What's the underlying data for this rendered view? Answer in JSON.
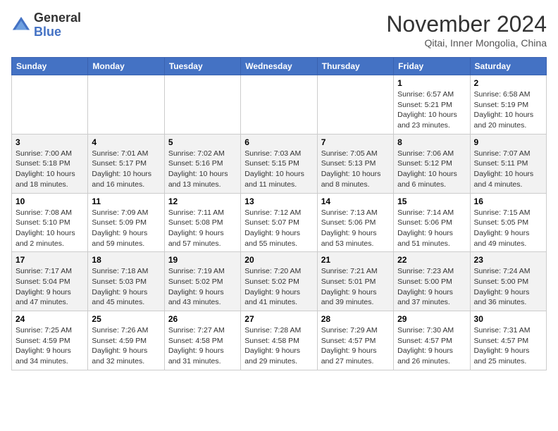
{
  "header": {
    "logo_general": "General",
    "logo_blue": "Blue",
    "title": "November 2024",
    "subtitle": "Qitai, Inner Mongolia, China"
  },
  "weekdays": [
    "Sunday",
    "Monday",
    "Tuesday",
    "Wednesday",
    "Thursday",
    "Friday",
    "Saturday"
  ],
  "weeks": [
    [
      {
        "day": "",
        "info": ""
      },
      {
        "day": "",
        "info": ""
      },
      {
        "day": "",
        "info": ""
      },
      {
        "day": "",
        "info": ""
      },
      {
        "day": "",
        "info": ""
      },
      {
        "day": "1",
        "info": "Sunrise: 6:57 AM\nSunset: 5:21 PM\nDaylight: 10 hours and 23 minutes."
      },
      {
        "day": "2",
        "info": "Sunrise: 6:58 AM\nSunset: 5:19 PM\nDaylight: 10 hours and 20 minutes."
      }
    ],
    [
      {
        "day": "3",
        "info": "Sunrise: 7:00 AM\nSunset: 5:18 PM\nDaylight: 10 hours and 18 minutes."
      },
      {
        "day": "4",
        "info": "Sunrise: 7:01 AM\nSunset: 5:17 PM\nDaylight: 10 hours and 16 minutes."
      },
      {
        "day": "5",
        "info": "Sunrise: 7:02 AM\nSunset: 5:16 PM\nDaylight: 10 hours and 13 minutes."
      },
      {
        "day": "6",
        "info": "Sunrise: 7:03 AM\nSunset: 5:15 PM\nDaylight: 10 hours and 11 minutes."
      },
      {
        "day": "7",
        "info": "Sunrise: 7:05 AM\nSunset: 5:13 PM\nDaylight: 10 hours and 8 minutes."
      },
      {
        "day": "8",
        "info": "Sunrise: 7:06 AM\nSunset: 5:12 PM\nDaylight: 10 hours and 6 minutes."
      },
      {
        "day": "9",
        "info": "Sunrise: 7:07 AM\nSunset: 5:11 PM\nDaylight: 10 hours and 4 minutes."
      }
    ],
    [
      {
        "day": "10",
        "info": "Sunrise: 7:08 AM\nSunset: 5:10 PM\nDaylight: 10 hours and 2 minutes."
      },
      {
        "day": "11",
        "info": "Sunrise: 7:09 AM\nSunset: 5:09 PM\nDaylight: 9 hours and 59 minutes."
      },
      {
        "day": "12",
        "info": "Sunrise: 7:11 AM\nSunset: 5:08 PM\nDaylight: 9 hours and 57 minutes."
      },
      {
        "day": "13",
        "info": "Sunrise: 7:12 AM\nSunset: 5:07 PM\nDaylight: 9 hours and 55 minutes."
      },
      {
        "day": "14",
        "info": "Sunrise: 7:13 AM\nSunset: 5:06 PM\nDaylight: 9 hours and 53 minutes."
      },
      {
        "day": "15",
        "info": "Sunrise: 7:14 AM\nSunset: 5:06 PM\nDaylight: 9 hours and 51 minutes."
      },
      {
        "day": "16",
        "info": "Sunrise: 7:15 AM\nSunset: 5:05 PM\nDaylight: 9 hours and 49 minutes."
      }
    ],
    [
      {
        "day": "17",
        "info": "Sunrise: 7:17 AM\nSunset: 5:04 PM\nDaylight: 9 hours and 47 minutes."
      },
      {
        "day": "18",
        "info": "Sunrise: 7:18 AM\nSunset: 5:03 PM\nDaylight: 9 hours and 45 minutes."
      },
      {
        "day": "19",
        "info": "Sunrise: 7:19 AM\nSunset: 5:02 PM\nDaylight: 9 hours and 43 minutes."
      },
      {
        "day": "20",
        "info": "Sunrise: 7:20 AM\nSunset: 5:02 PM\nDaylight: 9 hours and 41 minutes."
      },
      {
        "day": "21",
        "info": "Sunrise: 7:21 AM\nSunset: 5:01 PM\nDaylight: 9 hours and 39 minutes."
      },
      {
        "day": "22",
        "info": "Sunrise: 7:23 AM\nSunset: 5:00 PM\nDaylight: 9 hours and 37 minutes."
      },
      {
        "day": "23",
        "info": "Sunrise: 7:24 AM\nSunset: 5:00 PM\nDaylight: 9 hours and 36 minutes."
      }
    ],
    [
      {
        "day": "24",
        "info": "Sunrise: 7:25 AM\nSunset: 4:59 PM\nDaylight: 9 hours and 34 minutes."
      },
      {
        "day": "25",
        "info": "Sunrise: 7:26 AM\nSunset: 4:59 PM\nDaylight: 9 hours and 32 minutes."
      },
      {
        "day": "26",
        "info": "Sunrise: 7:27 AM\nSunset: 4:58 PM\nDaylight: 9 hours and 31 minutes."
      },
      {
        "day": "27",
        "info": "Sunrise: 7:28 AM\nSunset: 4:58 PM\nDaylight: 9 hours and 29 minutes."
      },
      {
        "day": "28",
        "info": "Sunrise: 7:29 AM\nSunset: 4:57 PM\nDaylight: 9 hours and 27 minutes."
      },
      {
        "day": "29",
        "info": "Sunrise: 7:30 AM\nSunset: 4:57 PM\nDaylight: 9 hours and 26 minutes."
      },
      {
        "day": "30",
        "info": "Sunrise: 7:31 AM\nSunset: 4:57 PM\nDaylight: 9 hours and 25 minutes."
      }
    ]
  ]
}
